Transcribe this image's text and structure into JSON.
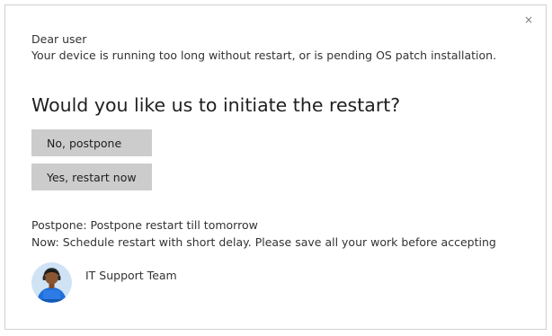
{
  "dialog": {
    "close_glyph": "×",
    "greeting": "Dear user",
    "message": "Your device is running too long without restart, or is pending OS patch installation.",
    "question": "Would you like us to initiate the restart?",
    "buttons": {
      "postpone": "No, postpone",
      "restart": "Yes, restart now"
    },
    "info": {
      "postpone": "Postpone: Postpone restart till tomorrow",
      "now": "Now: Schedule restart with short delay. Please save all your work before accepting"
    },
    "sender": "IT Support Team",
    "avatar_icon": "support-person-icon"
  },
  "colors": {
    "button_bg": "#cccccc",
    "border": "#d0d0d0",
    "avatar_bg": "#cfe3f5",
    "avatar_shirt": "#1e6fd9"
  }
}
